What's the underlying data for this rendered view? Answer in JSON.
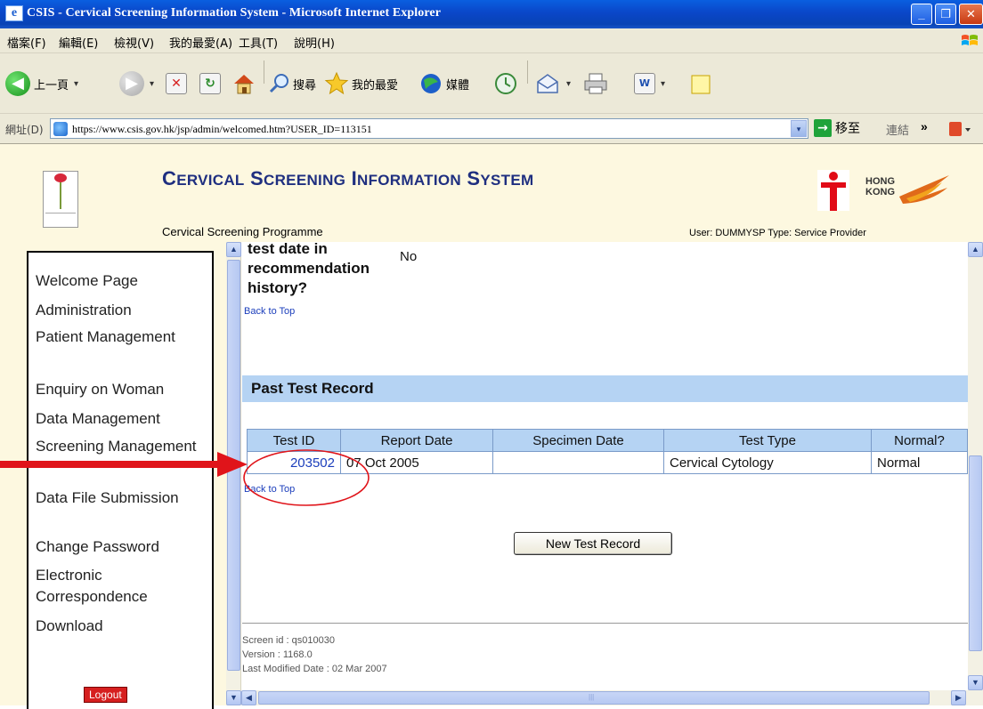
{
  "window": {
    "title": "CSIS - Cervical Screening Information System - Microsoft Internet Explorer",
    "min_label": "_",
    "max_label": "❐",
    "close_label": "✕",
    "app_icon": "e"
  },
  "menu": [
    "檔案(F)",
    "編輯(E)",
    "檢視(V)",
    "我的最愛(A)",
    "工具(T)",
    "說明(H)"
  ],
  "toolbar": {
    "back_label": "上一頁",
    "search_label": "搜尋",
    "favorites_label": "我的最愛",
    "media_label": "媒體",
    "back_glyph": "◀",
    "forward_glyph": "▶",
    "stop_glyph": "✕",
    "refresh_glyph": "↻",
    "dropdown_glyph": "▾",
    "word_glyph": "W"
  },
  "address": {
    "label": "網址(D)",
    "url": "https://www.csis.gov.hk/jsp/admin/welcomed.htm?USER_ID=113151",
    "go_label": "移至",
    "links_label": "連結",
    "dropdown_glyph": "▾",
    "go_glyph": "→",
    "more_glyph": "»"
  },
  "header": {
    "system_title_words": [
      {
        "cap": "C",
        "rest": "ERVICAL"
      },
      {
        "cap": "S",
        "rest": "CREENING"
      },
      {
        "cap": "I",
        "rest": "NFORMATION"
      },
      {
        "cap": "S",
        "rest": "YSTEM"
      }
    ],
    "program": "Cervical Screening Programme",
    "user_info": "User: DUMMYSP   Type: Service Provider",
    "hk_logo_text_1": "HONG",
    "hk_logo_text_2": "KONG"
  },
  "nav": {
    "items": [
      "Welcome Page",
      "Administration",
      "Patient Management",
      "Enquiry on Woman",
      "Data Management",
      "Screening Management",
      "Data File Submission",
      "Change Password",
      "Electronic Correspondence",
      "Download"
    ],
    "logout_label": "Logout"
  },
  "main": {
    "question": "test date in recommendation history?",
    "answer": "No",
    "back_to_top": "Back to Top",
    "section_title": "Past Test Record",
    "table": {
      "headers": [
        "Test ID",
        "Report Date",
        "Specimen Date",
        "Test Type",
        "Normal?"
      ],
      "rows": [
        [
          "203502",
          "07 Oct 2005",
          "",
          "Cervical Cytology",
          "Normal"
        ]
      ]
    },
    "new_test_button": "New Test Record",
    "footer": {
      "screen_id": "Screen id : qs010030",
      "version": "Version : 1168.0",
      "last_modified": "Last Modified Date : 02 Mar 2007"
    }
  },
  "scrollbars": {
    "up_glyph": "▲",
    "down_glyph": "▼",
    "left_glyph": "◀",
    "right_glyph": "▶",
    "grip_glyph": "|||"
  },
  "colors": {
    "accent": "#1f2f80",
    "section_bg": "#b5d3f3",
    "link": "#1a3dbb",
    "annotation": "#e0141a"
  }
}
